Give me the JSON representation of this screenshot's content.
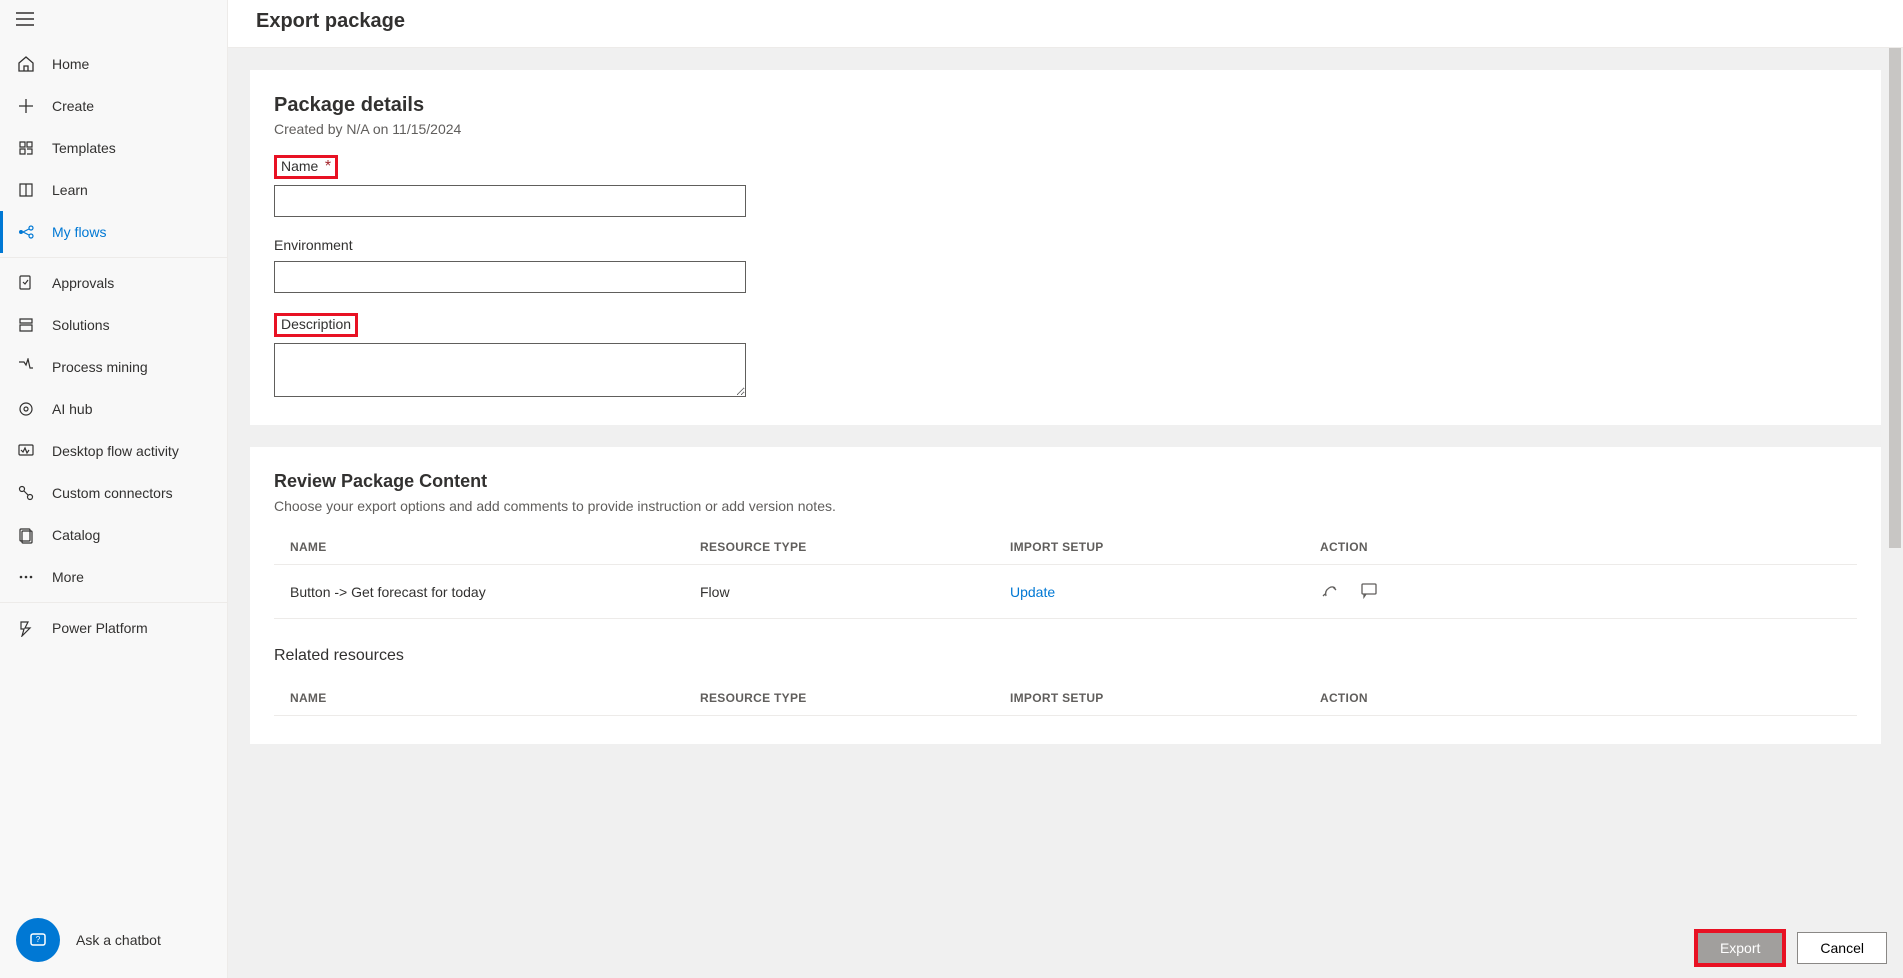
{
  "sidebar": {
    "items": [
      {
        "label": "Home",
        "icon": "home"
      },
      {
        "label": "Create",
        "icon": "plus"
      },
      {
        "label": "Templates",
        "icon": "templates"
      },
      {
        "label": "Learn",
        "icon": "learn"
      },
      {
        "label": "My flows",
        "icon": "flows",
        "active": true
      }
    ],
    "items2": [
      {
        "label": "Approvals",
        "icon": "approvals"
      },
      {
        "label": "Solutions",
        "icon": "solutions"
      },
      {
        "label": "Process mining",
        "icon": "process"
      },
      {
        "label": "AI hub",
        "icon": "ai"
      },
      {
        "label": "Desktop flow activity",
        "icon": "desktop"
      },
      {
        "label": "Custom connectors",
        "icon": "connectors"
      },
      {
        "label": "Catalog",
        "icon": "catalog"
      },
      {
        "label": "More",
        "icon": "more"
      }
    ],
    "items3": [
      {
        "label": "Power Platform",
        "icon": "power"
      }
    ],
    "chatbot": "Ask a chatbot"
  },
  "page": {
    "title": "Export package"
  },
  "details": {
    "heading": "Package details",
    "created": "Created by N/A on 11/15/2024",
    "name_label": "Name",
    "name_value": "",
    "env_label": "Environment",
    "env_value": "",
    "desc_label": "Description",
    "desc_value": ""
  },
  "review": {
    "heading": "Review Package Content",
    "sub": "Choose your export options and add comments to provide instruction or add version notes.",
    "headers": {
      "name": "NAME",
      "type": "RESOURCE TYPE",
      "setup": "IMPORT SETUP",
      "action": "ACTION"
    },
    "rows": [
      {
        "name": "Button -> Get forecast for today",
        "type": "Flow",
        "setup": "Update"
      }
    ],
    "related_heading": "Related resources"
  },
  "footer": {
    "export": "Export",
    "cancel": "Cancel"
  }
}
